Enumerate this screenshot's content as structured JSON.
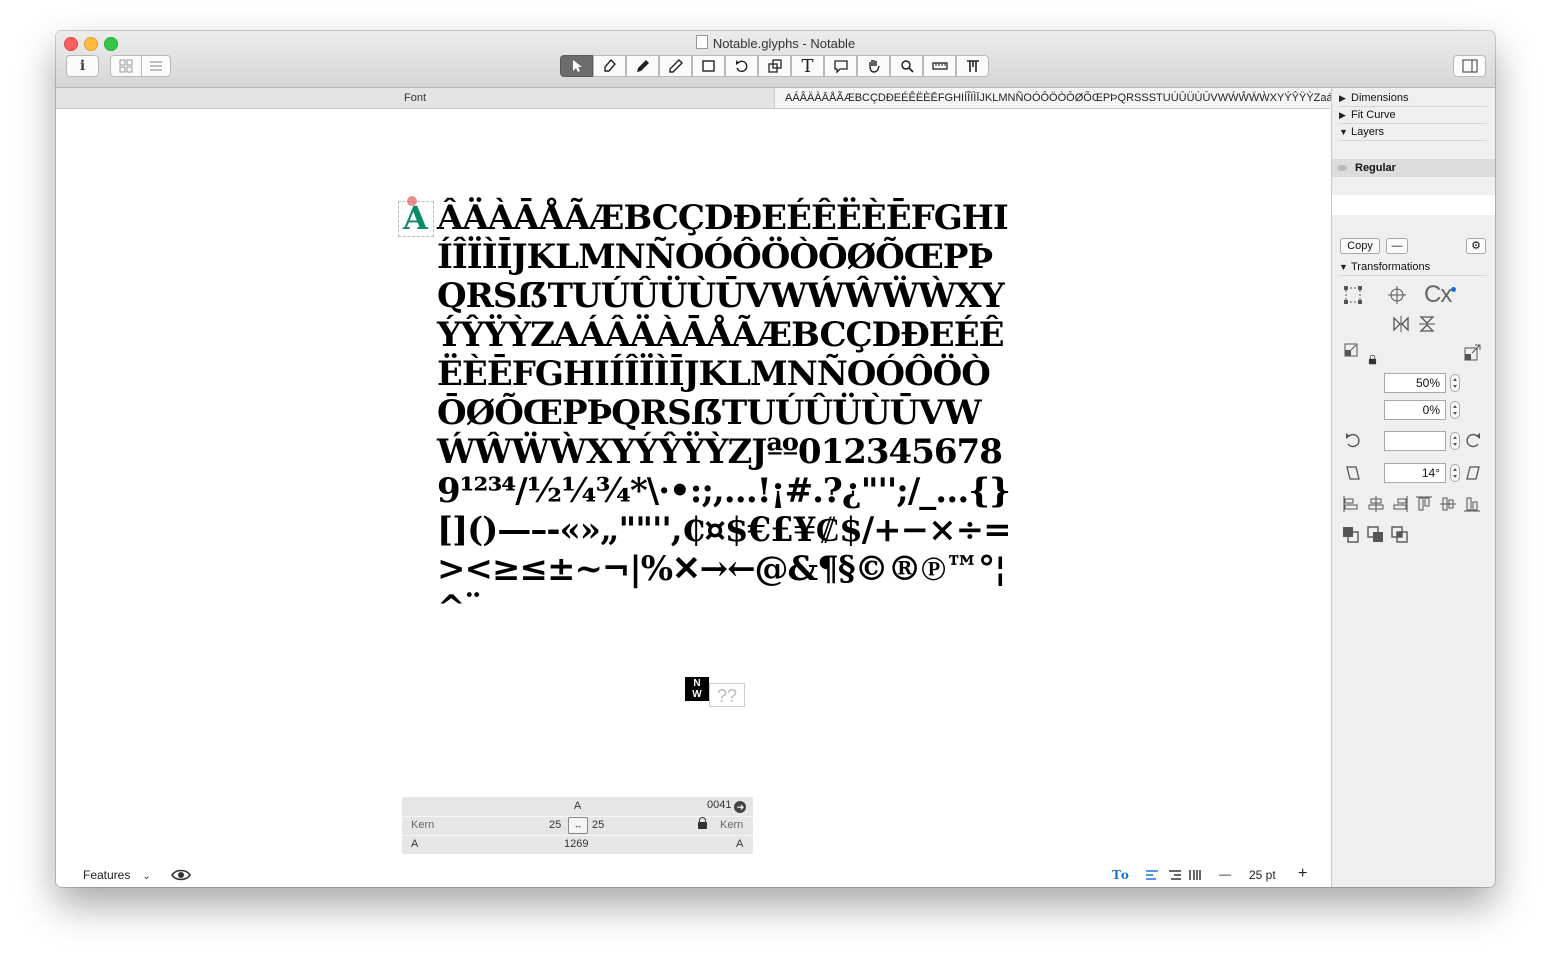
{
  "window": {
    "title": "Notable.glyphs - Notable"
  },
  "toolbar": {
    "info_label": "i",
    "text_tool_label": "T"
  },
  "tabs": {
    "font_label": "Font",
    "chars_preview": "AÁÂÄÀĀÅÃÆBCÇDĐEÉÊËÈĒFGHIÍÎÏÌĪJKLMNÑOÓÔÖÒŌØÕŒPÞQRSSSTUÚÛÜÙŪVWẂŴẄẀXYÝŶŸỲZaáâäàāåãæbcçdðeéêëèēf…"
  },
  "canvas": {
    "glyph_text": "ÂÄÀĀÅÃÆBCÇDĐEÉÊËÈĒFGHIÍÎÏÌĪJKLMNÑOÓÔÖÒŌØÕŒPÞQRSẞTUÚÛÜÙŪVWẂŴẄẀXYÝŶŸỲZAÁÂÄÀĀÅÃÆBCÇDĐEÉÊËÈĒFGHIÍÎÏÌĪJKLMNÑOÓÔÖÒŌØÕŒPÞQRSẞTUÚÛÜÙŪVWẂŴẄẀXYÝŶŸỲZJªº0123456789¹²³⁴/½¼¾*\\·•:;,…!¡#.?¿\"'';/_…{}[]()—–-«»„\"\"'',₵¤$€£¥₡$/+−×÷=><≥≤±~¬|%✕→←@&¶§©®℗™°¦^¨",
    "cursor_glyph": "A",
    "nw_label_top": "N",
    "nw_label_bottom": "W",
    "missing_glyph": "??"
  },
  "info_panel": {
    "glyph_name": "A",
    "unicode": "0041",
    "left_kern_label": "Kern",
    "right_kern_label": "Kern",
    "lsb": "25",
    "rsb": "25",
    "left_group": "A",
    "width": "1269",
    "right_group": "A"
  },
  "bottom_bar": {
    "features_label": "Features",
    "size_label": "25 pt",
    "minus_label": "—",
    "plus_label": "+",
    "text_tool_label": "Tᴏ"
  },
  "sidebar": {
    "dimensions_label": "Dimensions",
    "fit_curve_label": "Fit Curve",
    "layers_label": "Layers",
    "layer_regular": "Regular",
    "copy_label": "Copy",
    "minus_label": "—",
    "transformations_label": "Transformations",
    "scale_x": "50%",
    "scale_y": "0%",
    "rotate": "",
    "slant": "14°",
    "cx_label": "Cx"
  },
  "colors": {
    "accent": "#1e6fd9",
    "active_tool": "#6c6c6c"
  }
}
